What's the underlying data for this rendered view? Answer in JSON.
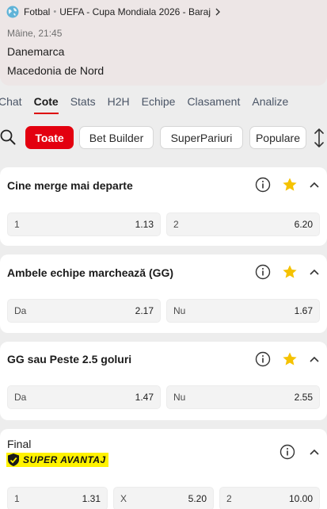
{
  "header": {
    "sport": "Fotbal",
    "competition": "UEFA - Cupa Mondiala 2026 - Baraj",
    "time": "Mâine, 21:45",
    "home_team": "Danemarca",
    "away_team": "Macedonia de Nord"
  },
  "tabs": [
    "Chat",
    "Cote",
    "Stats",
    "H2H",
    "Echipe",
    "Clasament",
    "Analize"
  ],
  "active_tab": "Cote",
  "filters": [
    "Toate",
    "Bet Builder",
    "SuperPariuri",
    "Populare"
  ],
  "markets": [
    {
      "title": "Cine merge mai departe",
      "odds": [
        {
          "label": "1",
          "value": "1.13"
        },
        {
          "label": "2",
          "value": "6.20"
        }
      ]
    },
    {
      "title": "Ambele echipe marchează (GG)",
      "odds": [
        {
          "label": "Da",
          "value": "2.17"
        },
        {
          "label": "Nu",
          "value": "1.67"
        }
      ]
    },
    {
      "title": "GG sau Peste 2.5 goluri",
      "odds": [
        {
          "label": "Da",
          "value": "1.47"
        },
        {
          "label": "Nu",
          "value": "2.55"
        }
      ]
    },
    {
      "title": "Final",
      "badge": "SUPER AVANTAJ",
      "odds": [
        {
          "label": "1",
          "value": "1.31"
        },
        {
          "label": "X",
          "value": "5.20"
        },
        {
          "label": "2",
          "value": "10.00"
        }
      ]
    }
  ],
  "icons": {
    "breadcrumb": "globe-icon",
    "breadcrumb_arrow": "chevron-right-icon",
    "search": "search-icon",
    "sort": "sort-arrows-icon",
    "info": "info-icon",
    "favorite": "star-icon",
    "collapse": "chevron-up-icon",
    "badge": "shield-check-icon"
  },
  "colors": {
    "accent": "#e3000f",
    "star": "#f5c200",
    "badge_bg": "#fff200",
    "header_bg": "#ede6e6",
    "page_bg": "#ededed"
  }
}
